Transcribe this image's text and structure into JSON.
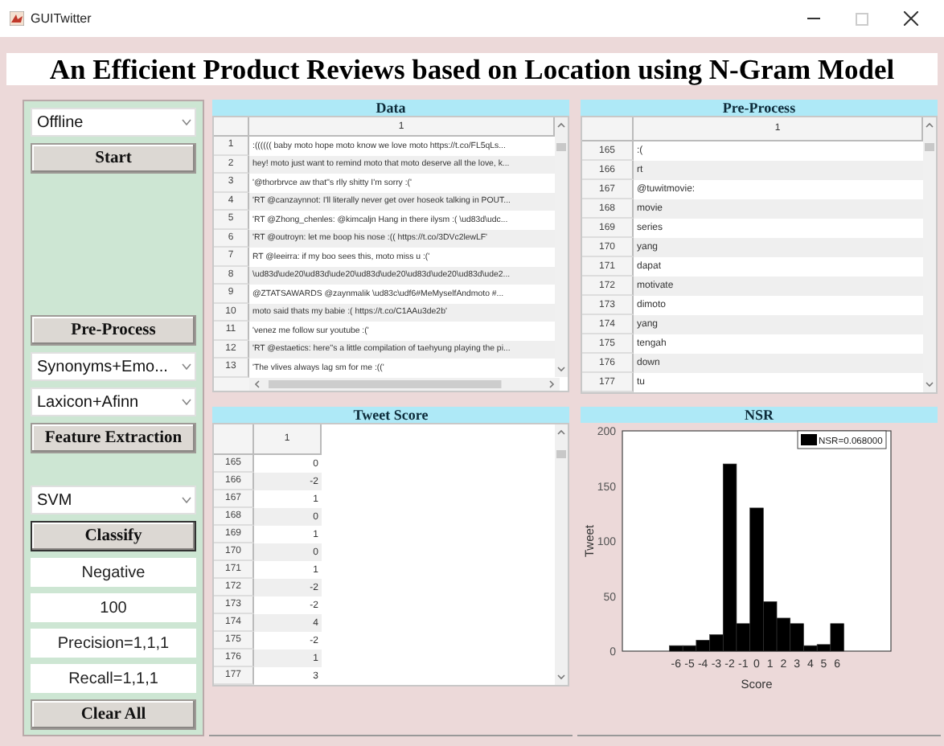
{
  "window": {
    "title": "GUITwitter"
  },
  "heading": "An Efficient Product Reviews based on Location using N-Gram Model",
  "control_groups": [
    [
      {
        "kind": "dropdown",
        "value": "Offline"
      },
      {
        "kind": "button",
        "label": "Start",
        "focused": false
      }
    ],
    [
      {
        "kind": "button",
        "label": "Pre-Process",
        "focused": false
      },
      {
        "kind": "dropdown",
        "value": "Synonyms+Emo..."
      },
      {
        "kind": "dropdown",
        "value": "Laxicon+Afinn"
      },
      {
        "kind": "button",
        "label": "Feature Extraction",
        "focused": false
      }
    ],
    [
      {
        "kind": "dropdown",
        "value": "SVM"
      },
      {
        "kind": "button",
        "label": "Classify",
        "focused": true
      },
      {
        "kind": "output",
        "value": "Negative"
      },
      {
        "kind": "output",
        "value": "100"
      },
      {
        "kind": "output",
        "value": "Precision=1,1,1"
      },
      {
        "kind": "output",
        "value": "Recall=1,1,1"
      },
      {
        "kind": "button",
        "label": "Clear All",
        "focused": false
      }
    ]
  ],
  "data_panel": {
    "title": "Data",
    "columns": [
      "1"
    ],
    "rows": [
      {
        "index": "1",
        "cells": [
          ":(((((( baby moto hope moto know we love moto https://t.co/FL5qLs..."
        ]
      },
      {
        "index": "2",
        "cells": [
          "hey! moto just want to remind moto that moto deserve all the love, k..."
        ]
      },
      {
        "index": "3",
        "cells": [
          "'@thorbrvce aw that''s rlly shitty I'm sorry :('"
        ]
      },
      {
        "index": "4",
        "cells": [
          "'RT @canzaynnot: I'll literally never get over hoseok talking in POUT..."
        ]
      },
      {
        "index": "5",
        "cells": [
          "'RT @Zhong_chenles: @kimcaljn Hang in there ilysm :( \\ud83d\\udc..."
        ]
      },
      {
        "index": "6",
        "cells": [
          "'RT @outroyn: let me boop his nose :(( https://t.co/3DVc2lewLF'"
        ]
      },
      {
        "index": "7",
        "cells": [
          "RT @leeirra: if my boo sees this, moto miss u :('"
        ]
      },
      {
        "index": "8",
        "cells": [
          "\\ud83d\\ude20\\ud83d\\ude20\\ud83d\\ude20\\ud83d\\ude20\\ud83d\\ude2..."
        ]
      },
      {
        "index": "9",
        "cells": [
          "@ZTATSAWARDS @zaynmalik \\ud83c\\udf6#MeMyselfAndmoto #..."
        ]
      },
      {
        "index": "10",
        "cells": [
          "moto said thats my babie :( https://t.co/C1AAu3de2b'"
        ]
      },
      {
        "index": "11",
        "cells": [
          "'venez me follow sur youtube :('"
        ]
      },
      {
        "index": "12",
        "cells": [
          "'RT @estaetics: here''s a little compilation of taehyung playing the pi..."
        ]
      },
      {
        "index": "13",
        "cells": [
          "'The vlives always lag sm for me :(('"
        ]
      }
    ]
  },
  "preprocess_panel": {
    "title": "Pre-Process",
    "columns": [
      "1"
    ],
    "rows": [
      {
        "index": "165",
        "cells": [
          ":("
        ]
      },
      {
        "index": "166",
        "cells": [
          "rt"
        ]
      },
      {
        "index": "167",
        "cells": [
          "@tuwitmovie:"
        ]
      },
      {
        "index": "168",
        "cells": [
          "movie"
        ]
      },
      {
        "index": "169",
        "cells": [
          "series"
        ]
      },
      {
        "index": "170",
        "cells": [
          "yang"
        ]
      },
      {
        "index": "171",
        "cells": [
          "dapat"
        ]
      },
      {
        "index": "172",
        "cells": [
          "motivate"
        ]
      },
      {
        "index": "173",
        "cells": [
          "dimoto"
        ]
      },
      {
        "index": "174",
        "cells": [
          "yang"
        ]
      },
      {
        "index": "175",
        "cells": [
          "tengah"
        ]
      },
      {
        "index": "176",
        "cells": [
          "down"
        ]
      },
      {
        "index": "177",
        "cells": [
          "tu"
        ]
      }
    ]
  },
  "score_panel": {
    "title": "Tweet Score",
    "columns": [
      "1"
    ],
    "rows": [
      {
        "index": "165",
        "cells": [
          "0"
        ]
      },
      {
        "index": "166",
        "cells": [
          "-2"
        ]
      },
      {
        "index": "167",
        "cells": [
          "1"
        ]
      },
      {
        "index": "168",
        "cells": [
          "0"
        ]
      },
      {
        "index": "169",
        "cells": [
          "1"
        ]
      },
      {
        "index": "170",
        "cells": [
          "0"
        ]
      },
      {
        "index": "171",
        "cells": [
          "1"
        ]
      },
      {
        "index": "172",
        "cells": [
          "-2"
        ]
      },
      {
        "index": "173",
        "cells": [
          "-2"
        ]
      },
      {
        "index": "174",
        "cells": [
          "4"
        ]
      },
      {
        "index": "175",
        "cells": [
          "-2"
        ]
      },
      {
        "index": "176",
        "cells": [
          "1"
        ]
      },
      {
        "index": "177",
        "cells": [
          "3"
        ]
      }
    ]
  },
  "nsr_panel": {
    "title": "NSR",
    "chart_data": {
      "type": "bar",
      "xlabel": "Score",
      "ylabel": "Tweet",
      "categories": [
        "-6",
        "-5",
        "-4",
        "-3",
        "-2",
        "-1",
        "0",
        "1",
        "2",
        "3",
        "4",
        "5",
        "6"
      ],
      "series": [
        {
          "name": "NSR=0.068000",
          "color": "#000000",
          "values": [
            5,
            5,
            10,
            15,
            170,
            25,
            130,
            45,
            30,
            25,
            5,
            6,
            25
          ]
        }
      ],
      "ylim": [
        0,
        200
      ],
      "yticks": [
        0,
        50,
        100,
        150,
        200
      ]
    }
  }
}
